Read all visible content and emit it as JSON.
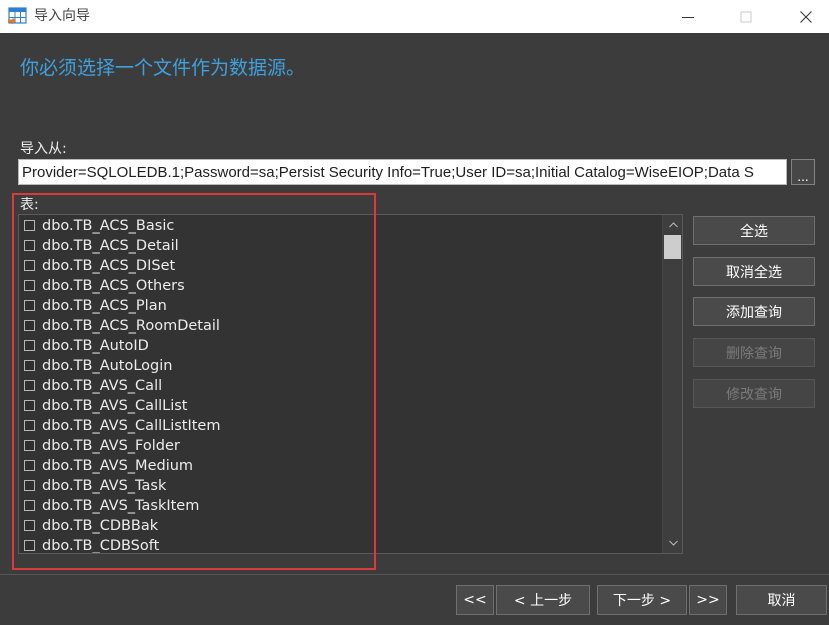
{
  "window": {
    "title": "导入向导",
    "app_icon": "table-import-icon",
    "controls": {
      "minimize": "minimize-icon",
      "maximize": "maximize-icon",
      "close": "close-icon"
    }
  },
  "colors": {
    "accent": "#3fa0de",
    "annotation": "#d93a3a",
    "background": "#3c3c3c"
  },
  "header": {
    "message": "你必须选择一个文件作为数据源。"
  },
  "source": {
    "label": "导入从:",
    "value": "Provider=SQLOLEDB.1;Password=sa;Persist Security Info=True;User ID=sa;Initial Catalog=WiseEIOP;Data S",
    "browse_label": "..."
  },
  "tables": {
    "label": "表:",
    "scroll_position": 0,
    "items": [
      {
        "name": "dbo.TB_ACS_Basic",
        "checked": false
      },
      {
        "name": "dbo.TB_ACS_Detail",
        "checked": false
      },
      {
        "name": "dbo.TB_ACS_DISet",
        "checked": false
      },
      {
        "name": "dbo.TB_ACS_Others",
        "checked": false
      },
      {
        "name": "dbo.TB_ACS_Plan",
        "checked": false
      },
      {
        "name": "dbo.TB_ACS_RoomDetail",
        "checked": false
      },
      {
        "name": "dbo.TB_AutoID",
        "checked": false
      },
      {
        "name": "dbo.TB_AutoLogin",
        "checked": false
      },
      {
        "name": "dbo.TB_AVS_Call",
        "checked": false
      },
      {
        "name": "dbo.TB_AVS_CallList",
        "checked": false
      },
      {
        "name": "dbo.TB_AVS_CallListItem",
        "checked": false
      },
      {
        "name": "dbo.TB_AVS_Folder",
        "checked": false
      },
      {
        "name": "dbo.TB_AVS_Medium",
        "checked": false
      },
      {
        "name": "dbo.TB_AVS_Task",
        "checked": false
      },
      {
        "name": "dbo.TB_AVS_TaskItem",
        "checked": false
      },
      {
        "name": "dbo.TB_CDBBak",
        "checked": false
      },
      {
        "name": "dbo.TB_CDBSoft",
        "checked": false
      }
    ]
  },
  "actions": {
    "select_all": {
      "label": "全选",
      "enabled": true
    },
    "deselect_all": {
      "label": "取消全选",
      "enabled": true
    },
    "add_query": {
      "label": "添加查询",
      "enabled": true
    },
    "delete_query": {
      "label": "删除查询",
      "enabled": false
    },
    "edit_query": {
      "label": "修改查询",
      "enabled": false
    }
  },
  "footer": {
    "first_label": "<<",
    "back_label": "< 上一步",
    "next_label": "下一步 >",
    "last_label": ">>",
    "cancel_label": "取消"
  }
}
